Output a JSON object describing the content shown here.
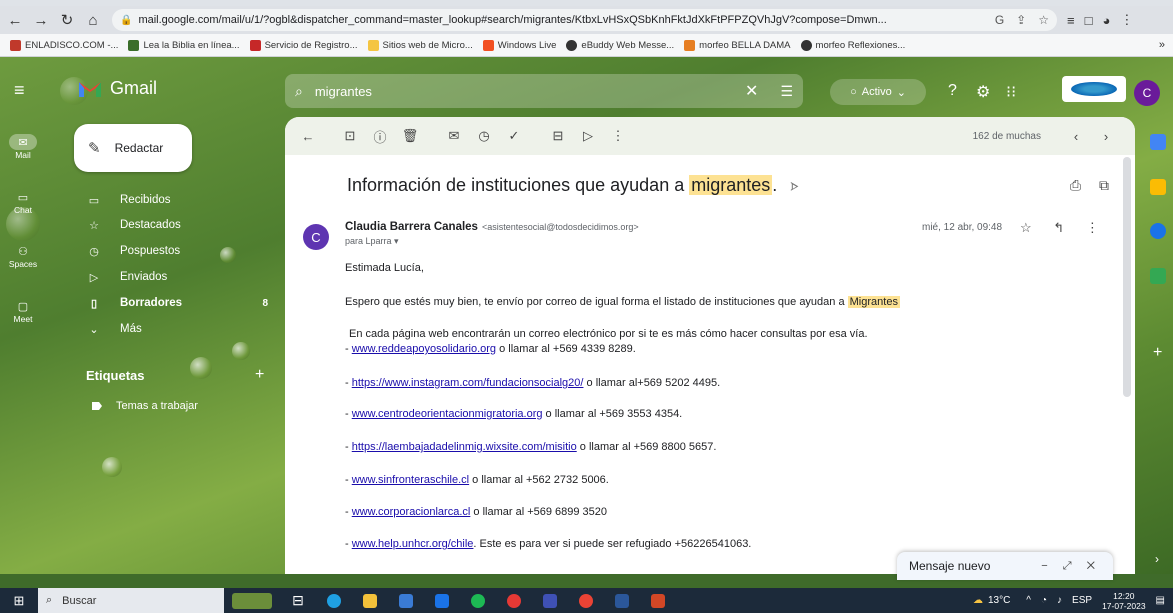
{
  "browser": {
    "url": "mail.google.com/mail/u/1/?ogbl&dispatcher_command=master_lookup#search/migrantes/KtbxLvHSxQSbKnhFktJdXkFtPFPZQVhJgV?compose=Dmwn...",
    "bookmarks": [
      {
        "label": "ENLADISCO.COM -...",
        "color": "#c0392b"
      },
      {
        "label": "Lea la Biblia en línea...",
        "color": "#3b6e2a"
      },
      {
        "label": "Servicio de Registro...",
        "color": "#c62828"
      },
      {
        "label": "Sitios web de Micro...",
        "color": "#f4c542"
      },
      {
        "label": "Windows Live",
        "color": "#f25022"
      },
      {
        "label": "eBuddy Web Messe...",
        "color": "#333333"
      },
      {
        "label": "morfeo BELLA DAMA",
        "color": "#e67e22"
      },
      {
        "label": "morfeo Reflexiones...",
        "color": "#333333"
      }
    ]
  },
  "gmail": {
    "app_name": "Gmail",
    "search_value": "migrantes",
    "status_label": "Activo",
    "account_initial": "C"
  },
  "rail": [
    {
      "label": "Mail"
    },
    {
      "label": "Chat"
    },
    {
      "label": "Spaces"
    },
    {
      "label": "Meet"
    }
  ],
  "compose_label": "Redactar",
  "nav": [
    {
      "label": "Recibidos",
      "count": ""
    },
    {
      "label": "Destacados",
      "count": ""
    },
    {
      "label": "Pospuestos",
      "count": ""
    },
    {
      "label": "Enviados",
      "count": ""
    },
    {
      "label": "Borradores",
      "count": "8"
    },
    {
      "label": "Más",
      "count": ""
    }
  ],
  "labels_header": "Etiquetas",
  "label_item": "Temas a trabajar",
  "toolbar": {
    "page_info": "162 de muchas"
  },
  "email": {
    "subject_prefix": "Información de instituciones que ayudan a ",
    "subject_highlight": "migrantes",
    "subject_suffix": ".",
    "sender_initial": "C",
    "sender_name": "Claudia Barrera Canales",
    "sender_email": "<asistentesocial@todosdecidimos.org>",
    "to": "para Lparra",
    "date": "mié, 12 abr, 09:48",
    "greeting": "Estimada Lucía,",
    "intro_prefix": "Espero que estés muy bien, te envío por correo de igual forma el listado de instituciones que ayudan a ",
    "intro_highlight": "Migrantes",
    "intro2": "En cada página web encontrarán un correo electrónico por si te es más cómo hacer consultas por esa vía.",
    "links": [
      {
        "prefix": "- ",
        "link": "www.reddeapoyosolidario.org",
        "suffix": " o llamar al +569 4339 8289."
      },
      {
        "prefix": "- ",
        "link": "https://www.instagram.com/fundacionsocialg20/",
        "suffix": " o llamar al+569 5202 4495."
      },
      {
        "prefix": "- ",
        "link": "www.centrodeorientacionmigratoria.org",
        "suffix": " o llamar al +569 3553 4354."
      },
      {
        "prefix": "-  ",
        "link": "https://laembajadadelinmig.wixsite.com/misitio",
        "suffix": " o llamar al +569 8800 5657."
      },
      {
        "prefix": "-  ",
        "link": "www.sinfronteraschile.cl",
        "suffix": " o llamar al +562 2732 5006."
      },
      {
        "prefix": "-  ",
        "link": "www.corporacionlarca.cl",
        "suffix": " o llamar al +569 6899 3520"
      },
      {
        "prefix": "- ",
        "link": "www.help.unhcr.org/chile",
        "suffix": ". Este es para ver si puede ser refugiado +56226541063."
      }
    ]
  },
  "popup": {
    "title": "Mensaje nuevo"
  },
  "taskbar": {
    "search_label": "Buscar",
    "weather": "13°C",
    "lang": "ESP",
    "time": "12:20",
    "date": "17-07-2023"
  }
}
